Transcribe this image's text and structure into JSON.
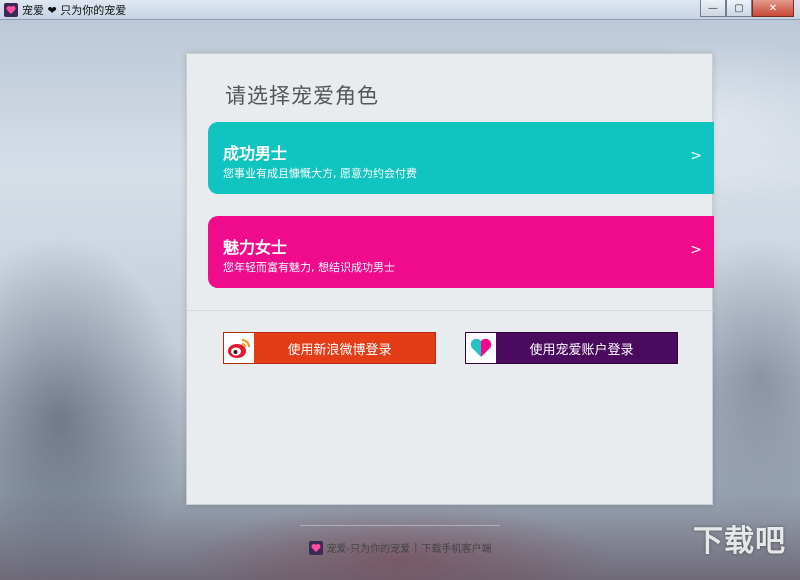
{
  "window": {
    "title": "宠爱 ❤ 只为你的宠爱",
    "minimize_label": "—",
    "maximize_label": "▢",
    "close_label": "✕"
  },
  "panel": {
    "heading": "请选择宠爱角色",
    "roles": [
      {
        "title": "成功男士",
        "description": "您事业有成且慷慨大方, 愿意为约会付费",
        "arrow": ">",
        "color": "#10c4c0"
      },
      {
        "title": "魅力女士",
        "description": "您年轻而富有魅力, 想结识成功男士",
        "arrow": ">",
        "color": "#ef0b8c"
      }
    ],
    "weibo_login_label": "使用新浪微博登录",
    "chongai_login_label": "使用宠爱账户登录"
  },
  "footer": {
    "app_name": "宠爱-只为你的宠爱",
    "separator": "|",
    "download_link": "下载手机客户端"
  },
  "watermark": "下载吧"
}
